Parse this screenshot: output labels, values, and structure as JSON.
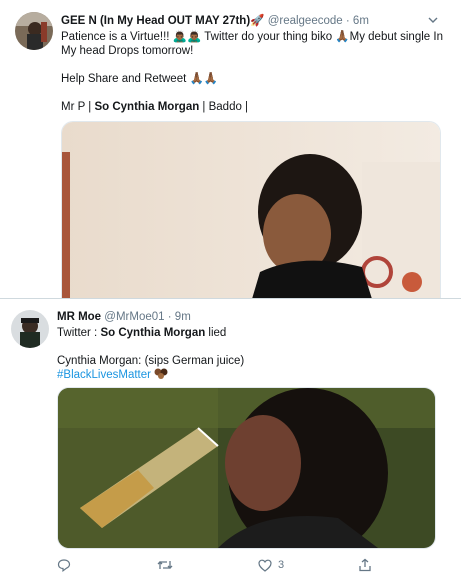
{
  "tweet1": {
    "display_name": "GEE N (In My Head OUT MAY 27th)",
    "handle": "@realgeecode",
    "dot": "·",
    "time": "6m",
    "line1": "Patience is a Virtue!!! 🙇🏾‍♂️🙇🏾‍♂️ Twitter do your thing biko 🙏🏾My debut single In",
    "line2": "My head Drops tomorrow!",
    "line3": "Help Share and Retweet 🙏🏾🙏🏾",
    "line4_prefix": "Mr P | ",
    "line4_bold": "So Cynthia Morgan",
    "line4_suffix": " | Baddo |",
    "rocket_emoji": "🚀"
  },
  "tweet2": {
    "display_name": "MR Moe",
    "handle": "@MrMoe01",
    "dot": "·",
    "time": "9m",
    "line1_prefix": "Twitter : ",
    "line1_bold": "So Cynthia Morgan",
    "line1_suffix": " lied",
    "line2": "Cynthia Morgan: (sips German juice)",
    "hashtag": "#BlackLivesMatter",
    "actions": {
      "reply_count": "",
      "retweet_count": "",
      "like_count": "3",
      "share_count": ""
    }
  },
  "icons": {
    "menu": "chevron-down-icon",
    "reply": "reply-icon",
    "retweet": "retweet-icon",
    "like": "heart-icon",
    "share": "share-icon"
  },
  "colors": {
    "link": "#1b95e0",
    "muted": "#657786",
    "border": "#cfd9de"
  }
}
